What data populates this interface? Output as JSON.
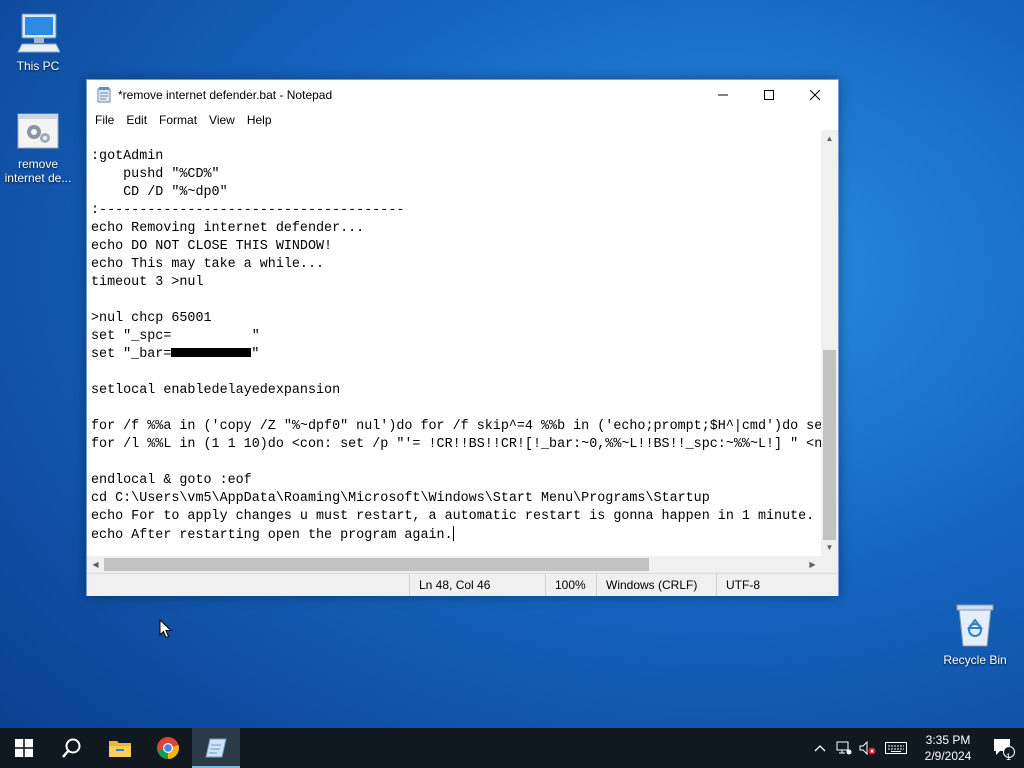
{
  "desktop": {
    "icons": [
      {
        "label": "This PC"
      },
      {
        "label": "remove internet de..."
      },
      {
        "label": "Recycle Bin"
      }
    ]
  },
  "notepad": {
    "title": "*remove internet defender.bat - Notepad",
    "menu": [
      "File",
      "Edit",
      "Format",
      "View",
      "Help"
    ],
    "lines": [
      ":gotAdmin",
      "    pushd \"%CD%\"",
      "    CD /D \"%~dp0\"",
      ":--------------------------------------",
      "echo Removing internet defender...",
      "echo DO NOT CLOSE THIS WINDOW!",
      "echo This may take a while...",
      "timeout 3 >nul",
      "",
      ">nul chcp 65001",
      "set \"_spc=          \"",
      "",
      "",
      "setlocal enabledelayedexpansion",
      "",
      "for /f %%a in ('copy /Z \"%~dpf0\" nul')do for /f skip^=4 %%b in ('echo;prompt;$H^|cmd')do se",
      "for /l %%L in (1 1 10)do <con: set /p \"'= !CR!!BS!!CR![!_bar:~0,%%~L!!BS!!_spc:~%%~L!] \" <n",
      "",
      "endlocal & goto :eof",
      "cd C:\\Users\\vm5\\AppData\\Roaming\\Microsoft\\Windows\\Start Menu\\Programs\\Startup",
      "echo For to apply changes u must restart, a automatic restart is gonna happen in 1 minute.",
      "echo After restarting open the program again."
    ],
    "bar_line_prefix": "set \"_bar=",
    "bar_line_suffix": "\"",
    "status": {
      "position": "Ln 48, Col 46",
      "zoom": "100%",
      "line_ending": "Windows (CRLF)",
      "encoding": "UTF-8"
    }
  },
  "taskbar": {
    "time": "3:35 PM",
    "date": "2/9/2024",
    "notification_count": "1"
  }
}
